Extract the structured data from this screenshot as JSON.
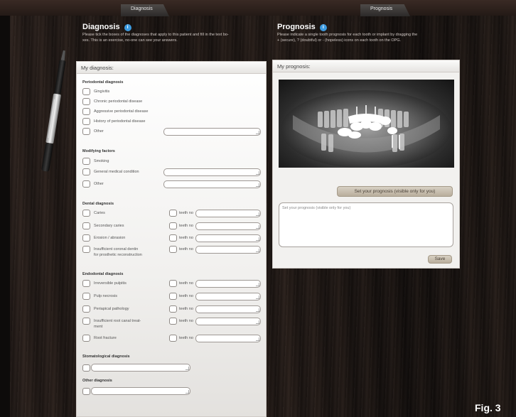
{
  "tabs": {
    "diagnosis": "Diagnosis",
    "prognosis": "Prognosis"
  },
  "diagnosis_section": {
    "title": "Diagnosis",
    "description_line1": "Please tick the boxes of the diagnoses that apply to this patient and fill in the text bo-",
    "description_line2": "xes. This is an exercise, no-one can see your answers."
  },
  "prognosis_section": {
    "title": "Prognosis",
    "description_line1": "Please indicate a single tooth prognosis for each tooth or implant by dragging the",
    "description_line2": "+ (secure), ? (doubtful) or - (hopeless) icons on each tooth on the OPG."
  },
  "diagnosis_panel": {
    "header": "My diagnosis:",
    "periodontal": {
      "title": "Periodontal diagnosis",
      "items": [
        "Gingivitis",
        "Chronic periodontal disease",
        "Aggressive periodontal disease",
        "History of periodontal disease",
        "Other"
      ]
    },
    "modifying": {
      "title": "Modifying factors",
      "items": [
        "Smoking",
        "General medical condition",
        "Other"
      ]
    },
    "dental": {
      "title": "Dental diagnosis",
      "items": [
        "Caries",
        "Secondary caries",
        "Erosion / abrasion",
        "Insufficient coronal dentin",
        "for prosthetic reconstruction"
      ],
      "teeth_label": "teeth no"
    },
    "endodontal": {
      "title": "Endodontal diagnosis",
      "items": [
        "Irreversible pulpitis",
        "Pulp necrosis",
        "Periapical pathology",
        "Insufficient root canal treat-",
        "ment",
        "Root fracture"
      ],
      "teeth_label": "teeth no"
    },
    "stomatological": {
      "title": "Stomatological diagnosis"
    },
    "other": {
      "title": "Other diagnosis"
    }
  },
  "prognosis_panel": {
    "header": "My prognosis:",
    "set_button": "Set your prognosis (visible only for you)",
    "textarea_placeholder": "Set your prognosis (visible only for you)",
    "save_button": "Save"
  },
  "figure_label": "Fig. 3",
  "colors": {
    "info_icon": "#3d9be0",
    "wood_dark": "#1a1412",
    "button": "#c8bfb0"
  }
}
